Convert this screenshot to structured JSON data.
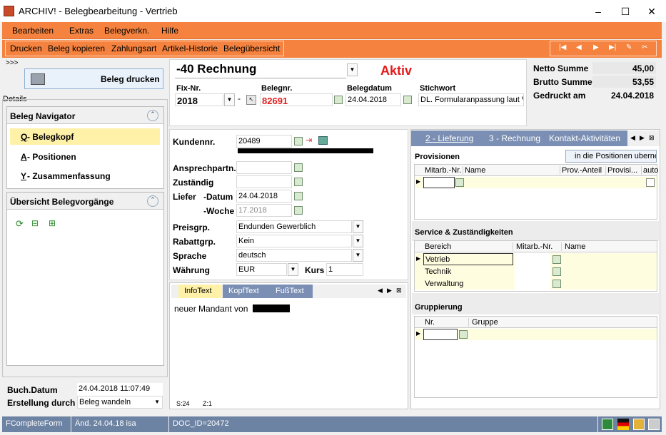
{
  "window": {
    "title": "ARCHIV! - Belegbearbeitung - Vertrieb"
  },
  "menu": [
    "Bearbeiten",
    "Extras",
    "Belegverkn.",
    "Hilfe"
  ],
  "toolbar": [
    "Drucken",
    "Beleg kopieren",
    "Zahlungsart",
    "Artikel-Historie",
    "Belegübersicht"
  ],
  "left": {
    "expand": ">>>",
    "print_btn": "Beleg drucken",
    "details": "Details",
    "nav_title": "Beleg Navigator",
    "nav_items": [
      {
        "key": "Q",
        "label": " - Belegkopf"
      },
      {
        "key": "A",
        "label": " - Positionen"
      },
      {
        "key": "Y",
        "label": " - Zusammenfassung"
      }
    ],
    "overview_title": "Übersicht Belegvorgänge",
    "buch_label": "Buch.Datum",
    "buch_value": "24.04.2018 11:07:49",
    "erst_label": "Erstellung durch",
    "erst_value": "Beleg wandeln"
  },
  "header": {
    "doctype": "-40 Rechnung",
    "status": "Aktiv",
    "fix_label": "Fix-Nr.",
    "fix_value": "2018",
    "dash": "-",
    "nr_label": "Belegnr.",
    "nr_value": "82691",
    "date_label": "Belegdatum",
    "date_value": "24.04.2018",
    "stich_label": "Stichwort",
    "stich_value": "DL. Formularanpassung laut V",
    "netto_label": "Netto Summe",
    "netto_value": "45,00",
    "brutto_label": "Brutto Summe",
    "brutto_value": "53,55",
    "printed_label": "Gedruckt am",
    "printed_value": "24.04.2018"
  },
  "customer": {
    "kunden_label": "Kundennr.",
    "kunden_value": "20489",
    "ansprech_label": "Ansprechpartn.",
    "zust_label": "Zuständig",
    "liefer_label": "Liefer",
    "datum_label": "-Datum",
    "datum_value": "24.04.2018",
    "woche_label": "-Woche",
    "woche_value": "17.2018",
    "preis_label": "Preisgrp.",
    "preis_value": "Endunden Gewerblich",
    "rabatt_label": "Rabattgrp.",
    "rabatt_value": "Kein",
    "sprache_label": "Sprache",
    "sprache_value": "deutsch",
    "waehrung_label": "Währung",
    "waehrung_value": "EUR",
    "kurs_label": "Kurs",
    "kurs_value": "1"
  },
  "infotabs": [
    "InfoText",
    "KopfText",
    "FußText"
  ],
  "infotext": "neuer Mandant von ",
  "infostatus": {
    "s": "S:24",
    "z": "Z:1"
  },
  "righttabs": [
    "2 - Lieferung",
    "3 - Rechnung",
    "Kontakt-Aktivitäten"
  ],
  "prov": {
    "title": "Provisionen",
    "btn": "in die Positionen uberne",
    "cols": [
      "Mitarb.-Nr.",
      "Name",
      "Prov.-Anteil",
      "Provisi...",
      "auto"
    ]
  },
  "service": {
    "title": "Service & Zuständigkeiten",
    "cols": [
      "Bereich",
      "Mitarb.-Nr.",
      "Name"
    ],
    "rows": [
      "Vetrieb",
      "Technik",
      "Verwaltung"
    ]
  },
  "grupp": {
    "title": "Gruppierung",
    "cols": [
      "Nr.",
      "Gruppe"
    ]
  },
  "statusbar": [
    "FCompleteForm",
    "Änd. 24.04.18 isa",
    "DOC_ID=20472"
  ]
}
